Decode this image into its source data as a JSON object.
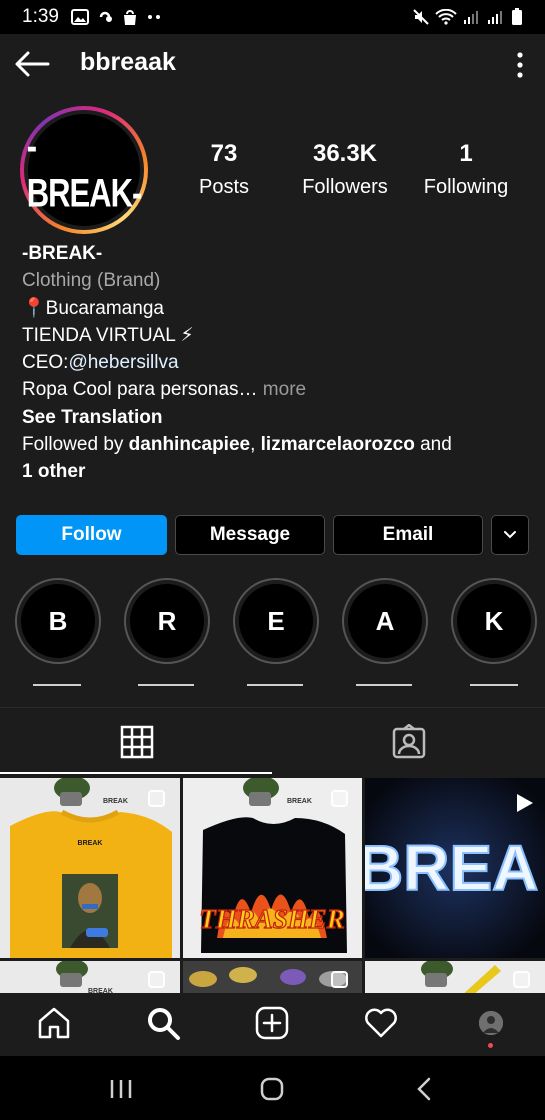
{
  "status_bar": {
    "time": "1:39",
    "icons": [
      "image-icon",
      "link-icon",
      "bag-icon",
      "more-dots-icon",
      "mute-icon",
      "wifi-icon",
      "signal-icon",
      "signal-icon",
      "battery-icon"
    ]
  },
  "top_nav": {
    "username": "bbreaak",
    "back_icon": "arrow-left-icon",
    "menu_icon": "vertical-dots-icon"
  },
  "profile": {
    "avatar_text": "-BREAK-",
    "stats": [
      {
        "value": "73",
        "label": "Posts"
      },
      {
        "value": "36.3K",
        "label": "Followers"
      },
      {
        "value": "1",
        "label": "Following"
      }
    ]
  },
  "bio": {
    "name": "-BREAK-",
    "category": "Clothing (Brand)",
    "location": "📍Bucaramanga",
    "store": "TIENDA VIRTUAL ⚡",
    "ceo_prefix": "CEO:",
    "ceo_handle": "@hebersillva",
    "tagline": "Ropa Cool para personas…",
    "more": " more",
    "see_translation": "See Translation",
    "followed_by_prefix": "Followed by ",
    "follower_one": "danhincapiee",
    "follower_sep": ", ",
    "follower_two": "lizmarcelaorozco",
    "followed_by_and": " and",
    "followed_by_other": "1 other"
  },
  "actions": {
    "follow": "Follow",
    "message": "Message",
    "email": "Email"
  },
  "highlights": [
    {
      "letter": "B",
      "label": "______"
    },
    {
      "letter": "R",
      "label": "______"
    },
    {
      "letter": "E",
      "label": "______"
    },
    {
      "letter": "A",
      "label": "______"
    },
    {
      "letter": "K",
      "label": "______"
    }
  ],
  "tabs": [
    "grid-icon",
    "tagged-icon"
  ],
  "grid": {
    "overlay_text": "BREA",
    "post_tag": "BREAK",
    "shirt_text_two": "THRASHER"
  },
  "bottom_nav": [
    "home-icon",
    "search-icon",
    "new-post-icon",
    "activity-heart-icon",
    "profile-avatar"
  ],
  "colors": {
    "follow_blue": "#0095f6",
    "background": "#1c1c1c",
    "notification_red": "#ed4956"
  }
}
